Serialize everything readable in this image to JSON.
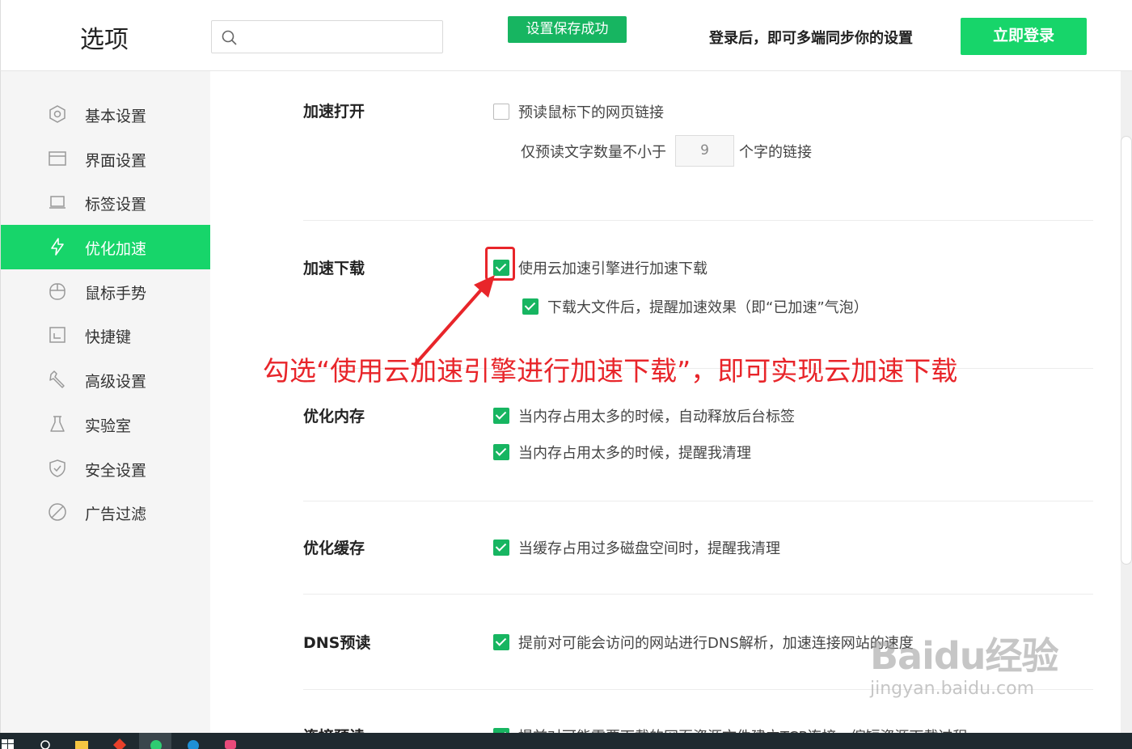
{
  "header": {
    "title": "选项",
    "search_placeholder": "",
    "toast": "设置保存成功",
    "sync_text": "登录后，即可多端同步你的设置",
    "login_button": "立即登录"
  },
  "sidebar": {
    "items": [
      {
        "label": "基本设置",
        "icon": "hexagon-icon"
      },
      {
        "label": "界面设置",
        "icon": "window-icon"
      },
      {
        "label": "标签设置",
        "icon": "tab-icon"
      },
      {
        "label": "优化加速",
        "icon": "lightning-icon",
        "active": true
      },
      {
        "label": "鼠标手势",
        "icon": "mouse-icon"
      },
      {
        "label": "快捷键",
        "icon": "keyboard-icon"
      },
      {
        "label": "高级设置",
        "icon": "wrench-icon"
      },
      {
        "label": "实验室",
        "icon": "flask-icon"
      },
      {
        "label": "安全设置",
        "icon": "shield-icon"
      },
      {
        "label": "广告过滤",
        "icon": "block-icon"
      }
    ]
  },
  "sections": {
    "speed_open": {
      "title": "加速打开",
      "prefetch_label": "预读鼠标下的网页链接",
      "prefetch_checked": false,
      "min_chars_prefix": "仅预读文字数量不小于",
      "min_chars_value": "9",
      "min_chars_suffix": "个字的链接"
    },
    "speed_download": {
      "title": "加速下载",
      "cloud_label": "使用云加速引擎进行加速下载",
      "cloud_checked": true,
      "remind_label": "下载大文件后，提醒加速效果（即“已加速”气泡）",
      "remind_checked": true
    },
    "memory": {
      "title": "优化内存",
      "release_label": "当内存占用太多的时候，自动释放后台标签",
      "remind_label": "当内存占用太多的时候，提醒我清理"
    },
    "cache": {
      "title": "优化缓存",
      "remind_label": "当缓存占用过多磁盘空间时，提醒我清理"
    },
    "dns": {
      "title": "DNS预读",
      "label": "提前对可能会访问的网站进行DNS解析，加速连接网站的速度"
    },
    "preconnect": {
      "title": "连接预读",
      "label": "提前对可能需要下载的网页资源文件建立TCP连接，缩短资源下载过程"
    }
  },
  "annotation": {
    "text": "勾选“使用云加速引擎进行加速下载”，即可实现云加速下载",
    "color": "#e8252a"
  },
  "watermark": {
    "logo": "Baidu经验",
    "url": "jingyan.baidu.com"
  },
  "colors": {
    "accent": "#17d56a",
    "checkbox": "#17b561"
  }
}
